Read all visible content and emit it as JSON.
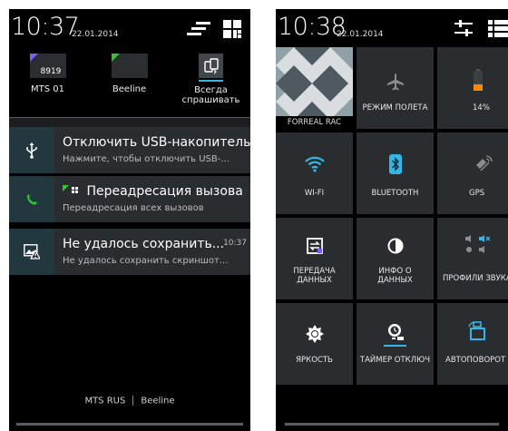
{
  "left": {
    "time": "10:37",
    "date": "22.01.2014",
    "sims": [
      {
        "number": "8919",
        "label": "MTS 01",
        "corner_color": "#7b5cff"
      },
      {
        "number": "",
        "label": "Beeline",
        "corner_color": "#2ec832"
      },
      {
        "number": "",
        "label": "Всегда\nспрашивать"
      }
    ],
    "notifications": [
      {
        "title": "Отключить USB-накопитель",
        "text": "Нажмите, чтобы отключить USB-...",
        "time": ""
      },
      {
        "title": "Переадресация вызова",
        "text": "Переадресация всех вызовов",
        "time": ""
      },
      {
        "title": "Не удалось сохранить...",
        "text": "Не удалось сохранить скриншот...",
        "time": "10:37"
      }
    ],
    "operators": [
      "MTS RUS",
      "Beeline"
    ]
  },
  "right": {
    "time": "10:38",
    "date": "22.01.2014",
    "tiles": [
      {
        "label": "FORREAL RAC"
      },
      {
        "label": "РЕЖИМ ПОЛЕТА"
      },
      {
        "label": "14%"
      },
      {
        "label": "WI-FI"
      },
      {
        "label": "BLUETOOTH"
      },
      {
        "label": "GPS"
      },
      {
        "label": "ПЕРЕДАЧА\nДАННЫХ"
      },
      {
        "label": "ИНФО О\nДАННЫХ"
      },
      {
        "label": "ПРОФИЛИ ЗВУКА"
      },
      {
        "label": "ЯРКОСТЬ"
      },
      {
        "label": "ТАЙМЕР ОТКЛЮЧ"
      },
      {
        "label": "АВТОПОВОРОТ"
      }
    ]
  },
  "colors": {
    "accent": "#33b5e5",
    "tile_bg": "#2a2d30",
    "notif_icon_bg": "#23373f",
    "battery": "#ff8800",
    "call_green": "#2ec832"
  }
}
